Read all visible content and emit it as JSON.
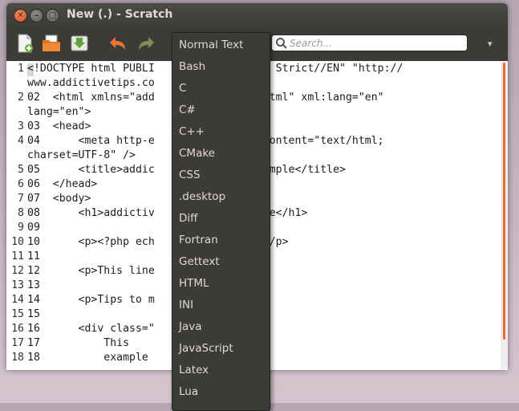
{
  "window": {
    "title": "New (.) - Scratch"
  },
  "toolbar": {
    "new_icon": "new-document-icon",
    "open_icon": "open-folder-icon",
    "save_icon": "save-download-icon",
    "undo_icon": "undo-arrow-icon",
    "redo_icon": "redo-arrow-icon",
    "search_placeholder": "Search...",
    "menu_arrow": "▾"
  },
  "editor": {
    "lines": [
      {
        "n": "1",
        "text": "<!DOCTYPE html PUBLI       0 XHTML 1.0 Strict//EN\" \"http://"
      },
      {
        "n": "",
        "text": "www.addictivetips.co"
      },
      {
        "n": "2",
        "text": "02  <html xmlns=\"add         n/2011/xhtml\" xml:lang=\"en\""
      },
      {
        "n": "",
        "text": "lang=\"en\">"
      },
      {
        "n": "3",
        "text": "03  <head>"
      },
      {
        "n": "4",
        "text": "04      <meta http-e          -Type\" content=\"text/html;"
      },
      {
        "n": "",
        "text": "charset=UTF-8\" />"
      },
      {
        "n": "5",
        "text": "05      <title>addic          Code Example</title>"
      },
      {
        "n": "6",
        "text": "06  </head>"
      },
      {
        "n": "7",
        "text": "07  <body>"
      },
      {
        "n": "8",
        "text": "08      <h1>addictiv          e Example</h1>"
      },
      {
        "n": "9",
        "text": "09"
      },
      {
        "n": "10",
        "text": "10      <p><?php ech          d!'; ?></p>"
      },
      {
        "n": "11",
        "text": "11"
      },
      {
        "n": "12",
        "text": "12      <p>This line          ed.</p>"
      },
      {
        "n": "13",
        "text": "13"
      },
      {
        "n": "14",
        "text": "14      <p>Tips to m          er.</p>"
      },
      {
        "n": "15",
        "text": "15"
      },
      {
        "n": "16",
        "text": "16      <div class=\""
      },
      {
        "n": "17",
        "text": "17          This"
      },
      {
        "n": "18",
        "text": "18          example"
      }
    ]
  },
  "menu": {
    "items": [
      "Normal Text",
      "Bash",
      "C",
      "C#",
      "C++",
      "CMake",
      "CSS",
      ".desktop",
      "Diff",
      "Fortran",
      "Gettext",
      "HTML",
      "INI",
      "Java",
      "JavaScript",
      "Latex",
      "Lua"
    ]
  },
  "colors": {
    "accent": "#ee6a2d",
    "chrome": "#3c3b37",
    "close_button": "#e0561f"
  }
}
